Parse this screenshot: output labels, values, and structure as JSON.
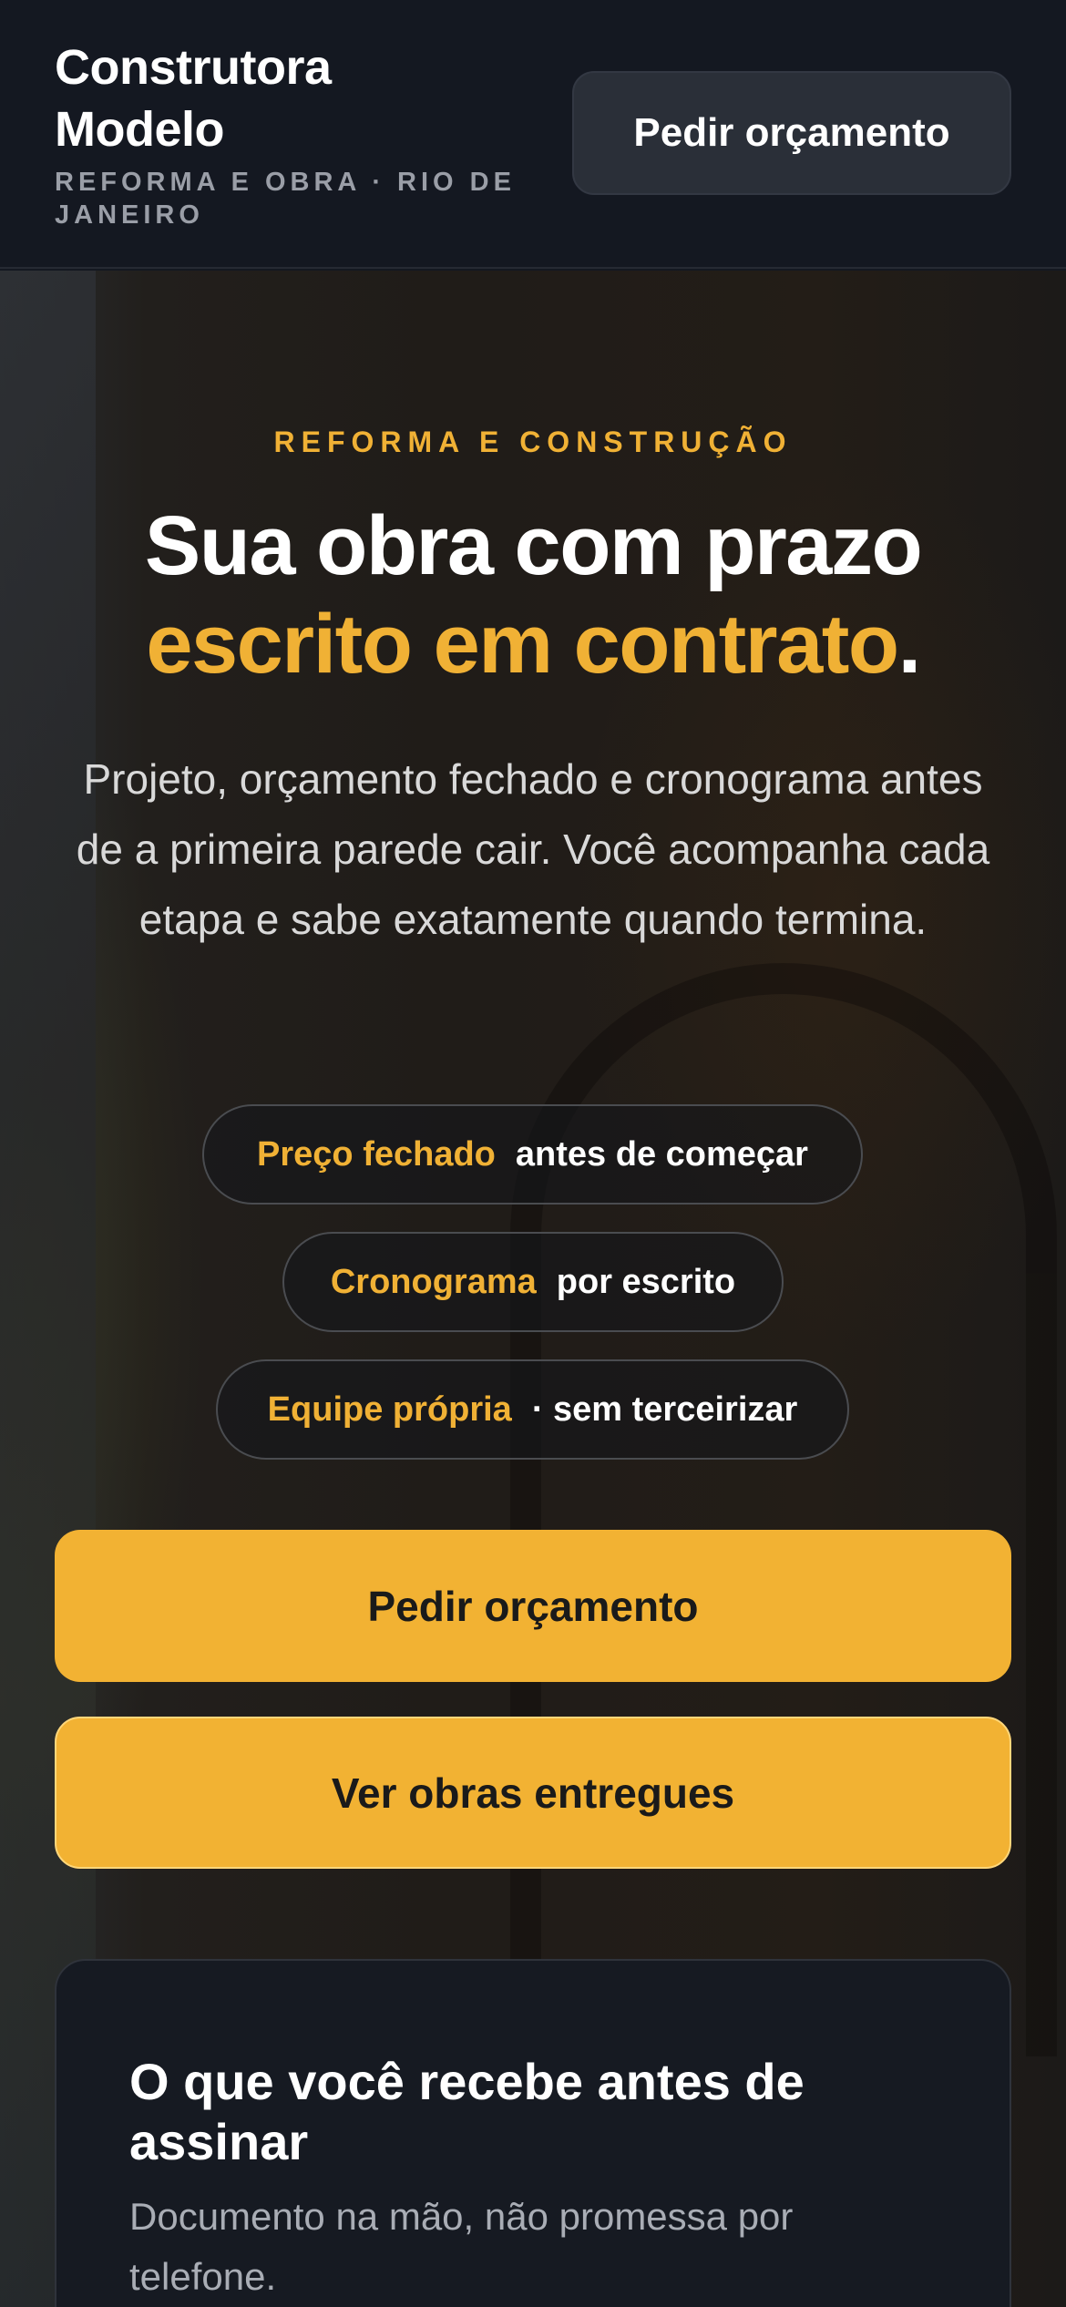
{
  "header": {
    "brand_line1": "Construtora",
    "brand_line2": "Modelo",
    "tagline": "REFORMA E OBRA · RIO DE JANEIRO",
    "cta_label": "Pedir orçamento"
  },
  "hero": {
    "eyebrow": "REFORMA E CONSTRUÇÃO",
    "headline_line1": "Sua obra com prazo",
    "headline_accent": "escrito em contrato",
    "headline_end": ".",
    "lead": "Projeto, orçamento fechado e cronograma antes de a primeira parede cair. Você acompanha cada etapa e sabe exatamente quando termina.",
    "pills": [
      {
        "strong": "Preço fechado",
        "rest": "antes de começar"
      },
      {
        "strong": "Cronograma",
        "rest": "por escrito"
      },
      {
        "strong": "Equipe própria",
        "rest": "· sem terceirizar"
      }
    ],
    "primary_cta": "Pedir orçamento",
    "secondary_cta": "Ver obras entregues"
  },
  "card": {
    "title": "O que você recebe antes de assinar",
    "text": "Documento na mão, não promessa por telefone."
  },
  "colors": {
    "accent": "#f0b135",
    "background": "#141821",
    "button": "#f2b233"
  }
}
